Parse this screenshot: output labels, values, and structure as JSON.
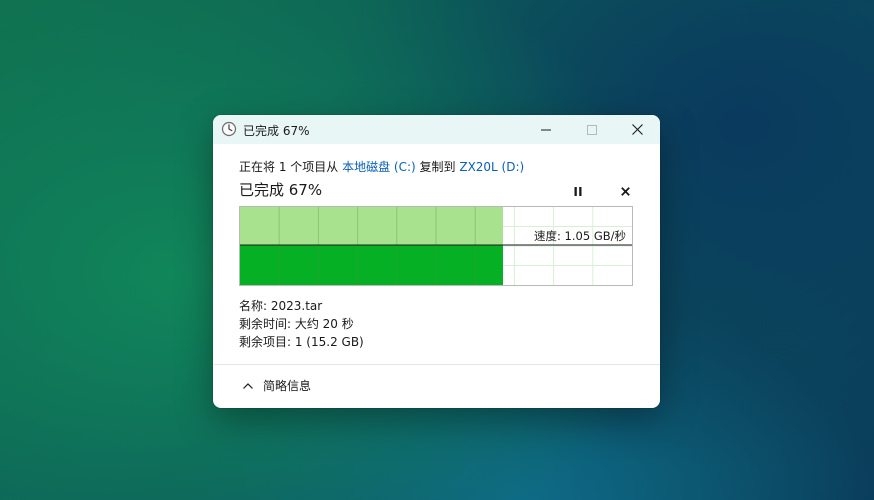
{
  "window": {
    "title": "已完成 67%",
    "icons": {
      "title": "clock-icon",
      "minimize": "minimize-icon",
      "maximize": "maximize-icon",
      "close": "close-icon"
    }
  },
  "transfer": {
    "prefix": "正在将 1 个项目从 ",
    "source": "本地磁盘 (C:)",
    "middle": " 复制到 ",
    "destination": "ZX20L (D:)",
    "heading": "已完成 67%",
    "progress_percent": 67,
    "speed": "速度: 1.05 GB/秒"
  },
  "details": {
    "name": "名称: 2023.tar",
    "time_remaining": "剩余时间: 大约 20 秒",
    "items_remaining": "剩余项目: 1 (15.2 GB)"
  },
  "footer": {
    "toggle_label": "简略信息"
  },
  "colors": {
    "progress_fill": "#06b025",
    "progress_light": "#a8e28f",
    "grid": "#d8eed8",
    "link": "#0a5fb8",
    "titlebar": "#e8f6f5"
  }
}
